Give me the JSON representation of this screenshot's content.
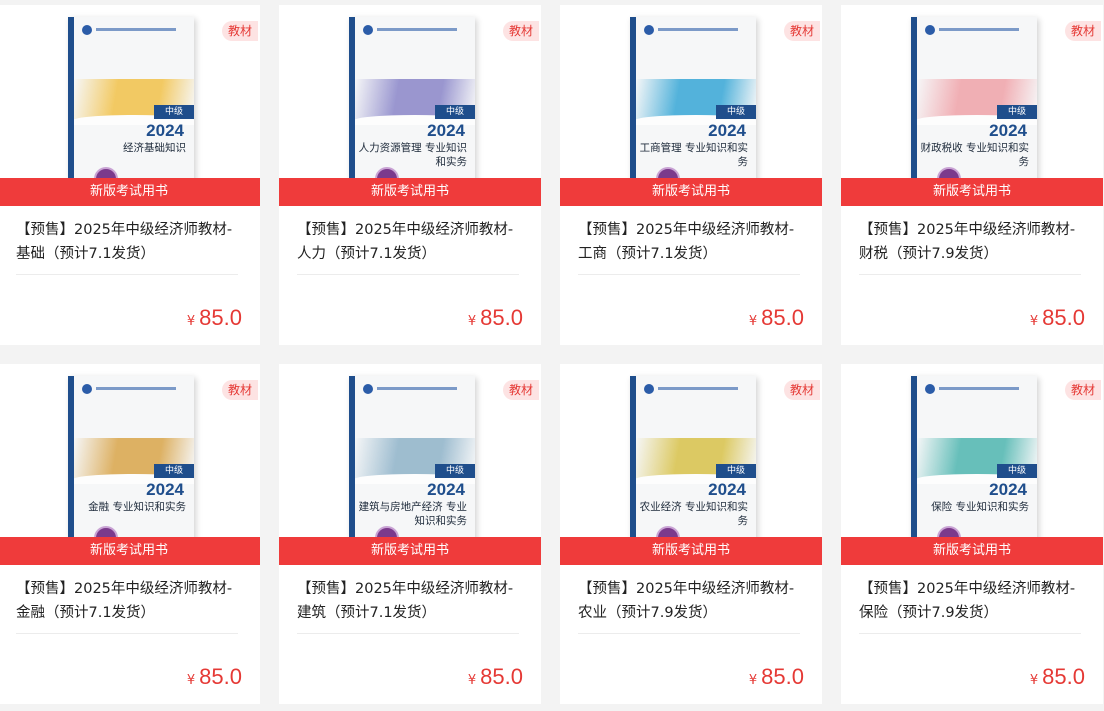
{
  "colors": {
    "accent": "#ef3b3b",
    "price": "#e53935",
    "badge_bg": "#fde3e3",
    "book_blue": "#1f4e8c"
  },
  "products": [
    {
      "badge": "教材",
      "ribbon": "新版考试用书",
      "title": "【预售】2025年中级经济师教材-基础（预计7.1发货）",
      "currency": "¥",
      "price": "85.0",
      "cover": {
        "year": "2024",
        "level": "中级",
        "name": "经济基础知识",
        "band": "#f2c24a"
      }
    },
    {
      "badge": "教材",
      "ribbon": "新版考试用书",
      "title": "【预售】2025年中级经济师教材-人力（预计7.1发货）",
      "currency": "¥",
      "price": "85.0",
      "cover": {
        "year": "2024",
        "level": "中级",
        "name": "人力资源管理 专业知识和实务",
        "band": "#8a86c9"
      }
    },
    {
      "badge": "教材",
      "ribbon": "新版考试用书",
      "title": "【预售】2025年中级经济师教材-工商（预计7.1发货）",
      "currency": "¥",
      "price": "85.0",
      "cover": {
        "year": "2024",
        "level": "中级",
        "name": "工商管理 专业知识和实务",
        "band": "#37a7d6"
      }
    },
    {
      "badge": "教材",
      "ribbon": "新版考试用书",
      "title": "【预售】2025年中级经济师教材-财税（预计7.9发货）",
      "currency": "¥",
      "price": "85.0",
      "cover": {
        "year": "2024",
        "level": "中级",
        "name": "财政税收 专业知识和实务",
        "band": "#f0a3a9"
      }
    },
    {
      "badge": "教材",
      "ribbon": "新版考试用书",
      "title": "【预售】2025年中级经济师教材-金融（预计7.1发货）",
      "currency": "¥",
      "price": "85.0",
      "cover": {
        "year": "2024",
        "level": "中级",
        "name": "金融 专业知识和实务",
        "band": "#d9a54a"
      }
    },
    {
      "badge": "教材",
      "ribbon": "新版考试用书",
      "title": "【预售】2025年中级经济师教材-建筑（预计7.1发货）",
      "currency": "¥",
      "price": "85.0",
      "cover": {
        "year": "2024",
        "level": "中级",
        "name": "建筑与房地产经济 专业知识和实务",
        "band": "#8fb3c9"
      }
    },
    {
      "badge": "教材",
      "ribbon": "新版考试用书",
      "title": "【预售】2025年中级经济师教材-农业（预计7.9发货）",
      "currency": "¥",
      "price": "85.0",
      "cover": {
        "year": "2024",
        "level": "中级",
        "name": "农业经济 专业知识和实务",
        "band": "#d8c24a"
      }
    },
    {
      "badge": "教材",
      "ribbon": "新版考试用书",
      "title": "【预售】2025年中级经济师教材-保险（预计7.9发货）",
      "currency": "¥",
      "price": "85.0",
      "cover": {
        "year": "2024",
        "level": "中级",
        "name": "保险 专业知识和实务",
        "band": "#4fb6b0"
      }
    }
  ]
}
